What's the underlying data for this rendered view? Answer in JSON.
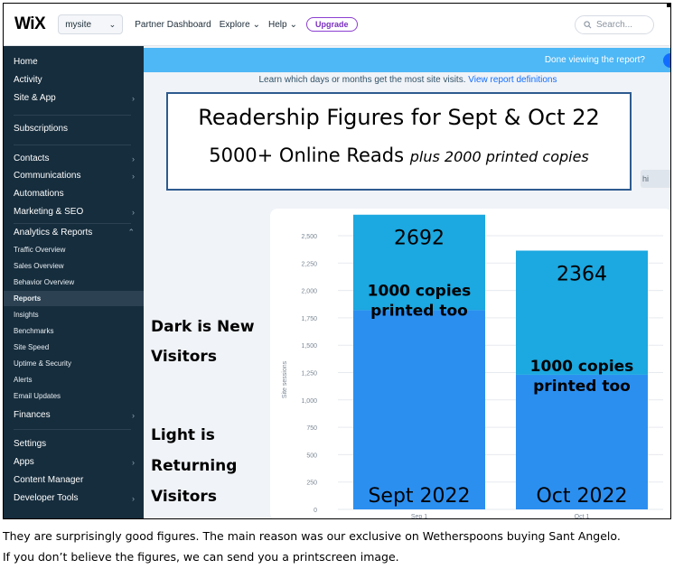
{
  "topbar": {
    "logo": "WiX",
    "site_name": "mysite",
    "links": [
      "Partner Dashboard",
      "Explore",
      "Help"
    ],
    "upgrade_label": "Upgrade",
    "search_placeholder": "Search..."
  },
  "sidebar": {
    "items": [
      {
        "label": "Home",
        "has_chevron": false
      },
      {
        "label": "Activity",
        "has_chevron": false
      },
      {
        "label": "Site & App",
        "has_chevron": true
      },
      {
        "label": "Subscriptions",
        "has_chevron": false
      },
      {
        "label": "Contacts",
        "has_chevron": true
      },
      {
        "label": "Communications",
        "has_chevron": true
      },
      {
        "label": "Automations",
        "has_chevron": false
      },
      {
        "label": "Marketing & SEO",
        "has_chevron": true
      },
      {
        "label": "Analytics & Reports",
        "has_chevron": true,
        "expanded": true
      }
    ],
    "analytics_subitems": [
      "Traffic Overview",
      "Sales Overview",
      "Behavior Overview",
      "Reports",
      "Insights",
      "Benchmarks",
      "Site Speed",
      "Uptime & Security",
      "Alerts",
      "Email Updates"
    ],
    "active_subitem": "Reports",
    "items_after": [
      {
        "label": "Finances",
        "has_chevron": true
      },
      {
        "label": "Settings",
        "has_chevron": false
      },
      {
        "label": "Apps",
        "has_chevron": true
      },
      {
        "label": "Content Manager",
        "has_chevron": false
      },
      {
        "label": "Developer Tools",
        "has_chevron": true
      }
    ]
  },
  "main": {
    "banner_text": "Done viewing the report?",
    "learn_text": "Learn which days or months get the most site visits.",
    "learn_link": "View report definitions",
    "behind_pill_text": "hi"
  },
  "overlay": {
    "headline_1": "Readership Figures for Sept & Oct 22",
    "headline_2_main": "5000+ Online Reads",
    "headline_2_italic": "plus 2000 printed copies",
    "dark_label_1": "Dark is New",
    "dark_label_2": "Visitors",
    "light_label_1": "Light is",
    "light_label_2": "Returning",
    "light_label_3": "Visitors"
  },
  "chart_data": {
    "type": "bar",
    "stacked": true,
    "ylabel": "Site sessions",
    "ylim": [
      0,
      2500
    ],
    "yticks": [
      0,
      250,
      500,
      750,
      1000,
      1250,
      1500,
      1750,
      2000,
      2250,
      2500
    ],
    "categories": [
      "Sep 1",
      "Oct 1"
    ],
    "series": [
      {
        "color": "#2b8ff0",
        "values": [
          1820,
          1230
        ]
      },
      {
        "color": "#1ca8e0",
        "values": [
          872,
          1134
        ]
      }
    ],
    "totals": [
      2692,
      2364
    ],
    "bar_annotations": [
      {
        "total_label": "2692",
        "note_1": "1000 copies",
        "note_2": "printed too",
        "bottom_label": "Sept 2022"
      },
      {
        "total_label": "2364",
        "note_1": "1000 copies",
        "note_2": "printed too",
        "bottom_label": "Oct 2022"
      }
    ]
  },
  "caption": {
    "line_1": "They are surprisingly good figures. The main reason was our exclusive on Wetherspoons buying Sant Angelo.",
    "line_2": "If you don’t believe the figures, we can send you a printscreen image."
  },
  "colors": {
    "sidebar_bg": "#162d3d",
    "banner": "#4eb7f5",
    "new_visitors": "#2b8ff0",
    "returning_visitors": "#1ca8e0",
    "headline_border": "#2e5b8f"
  }
}
